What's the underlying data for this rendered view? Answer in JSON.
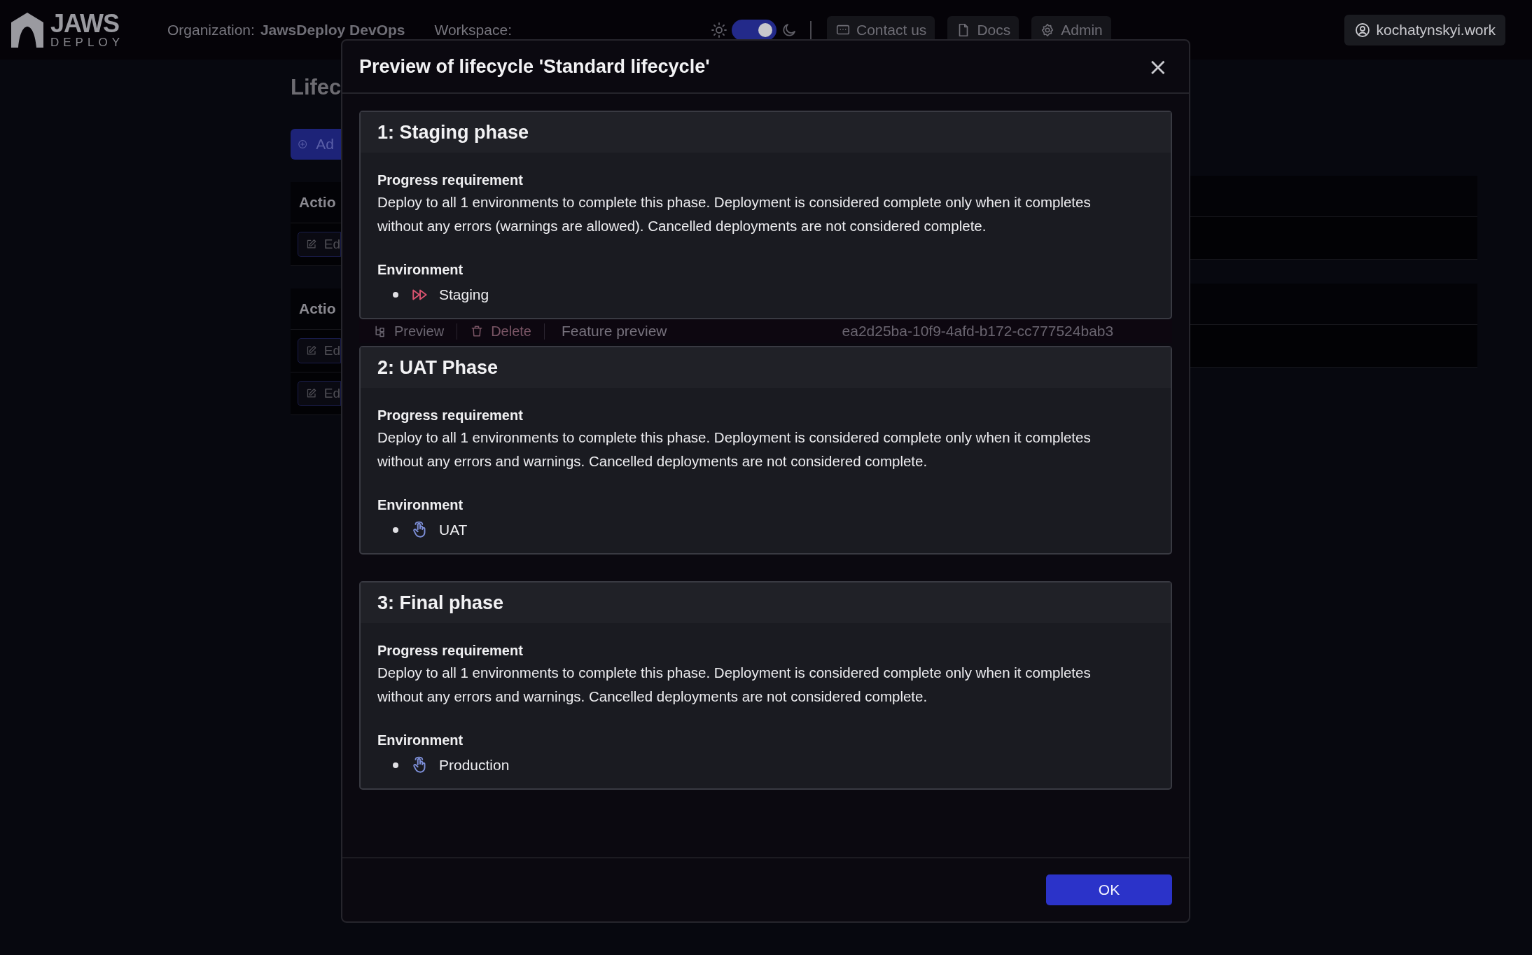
{
  "header": {
    "logo": {
      "word": "JAWS",
      "subword": "DEPLOY"
    },
    "organization_label": "Organization:",
    "organization": "JawsDeploy DevOps",
    "workspace_label": "Workspace:",
    "dark_mode": {
      "on": true
    },
    "buttons": [
      {
        "label": "Contact us",
        "kind": "chat"
      },
      {
        "label": "Docs",
        "kind": "doc"
      },
      {
        "label": "Admin",
        "kind": "gear"
      }
    ],
    "user": "kochatynskyi.work"
  },
  "background": {
    "page_title": "Lifec",
    "add_button": "Ad",
    "sections": [
      {
        "heading": "Actio",
        "edit_buttons": [
          "Ed"
        ]
      },
      {
        "heading": "Actio",
        "edit_buttons": [
          "Ed",
          "Ed"
        ]
      }
    ],
    "row": {
      "preview": "Preview",
      "delete": "Delete",
      "name": "Feature preview",
      "id": "ea2d25ba-10f9-4afd-b172-cc777524bab3"
    }
  },
  "dialog": {
    "title": "Preview of lifecycle 'Standard lifecycle'",
    "close": "×",
    "ok_button": "OK",
    "phases": [
      {
        "title": "1: Staging phase",
        "requirement_label": "Progress requirement",
        "requirement": "Deploy to all 1 environments to complete this phase. Deployment is considered complete only when it completes without any errors (warnings are allowed). Cancelled deployments are not considered complete.",
        "environment_label": "Environment",
        "environments": [
          {
            "name": "Staging",
            "kind": "fast-forward",
            "color": "#d9536f"
          }
        ]
      },
      {
        "title": "2: UAT Phase",
        "requirement_label": "Progress requirement",
        "requirement": "Deploy to all 1 environments to complete this phase. Deployment is considered complete only when it completes without any errors and warnings. Cancelled deployments are not considered complete.",
        "environment_label": "Environment",
        "environments": [
          {
            "name": "UAT",
            "kind": "touch",
            "color": "#7d8fd8"
          }
        ]
      },
      {
        "title": "3: Final phase",
        "requirement_label": "Progress requirement",
        "requirement": "Deploy to all 1 environments to complete this phase. Deployment is considered complete only when it completes without any errors and warnings. Cancelled deployments are not considered complete.",
        "environment_label": "Environment",
        "environments": [
          {
            "name": "Production",
            "kind": "touch",
            "color": "#7d8fd8"
          }
        ]
      }
    ]
  }
}
